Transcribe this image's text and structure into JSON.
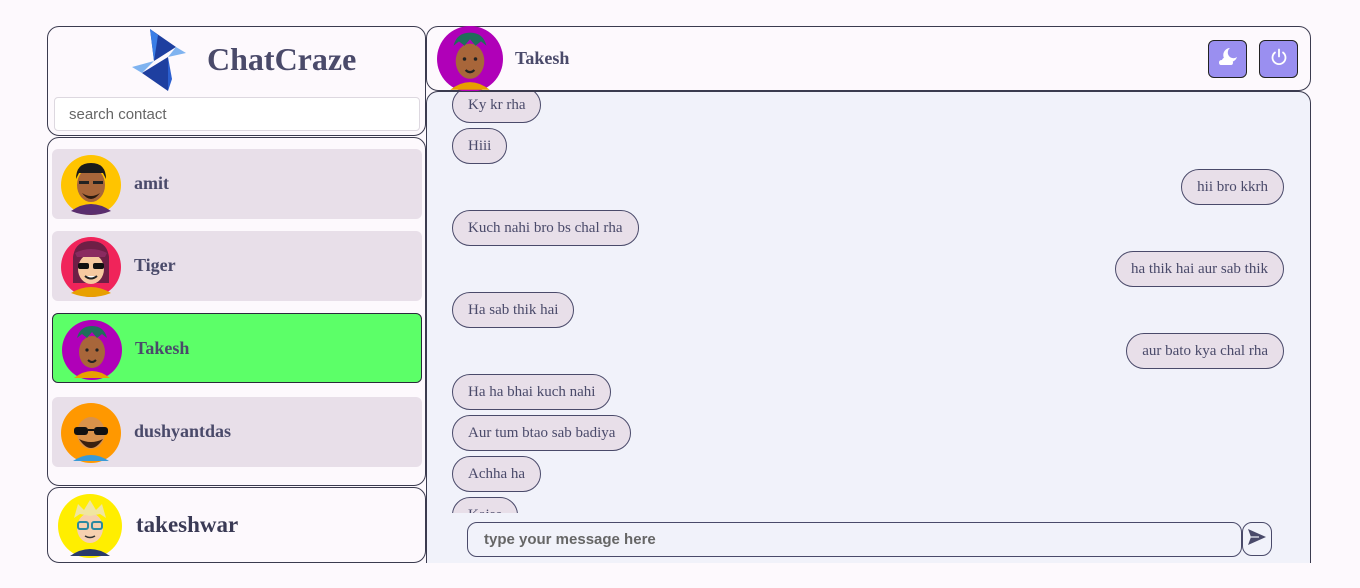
{
  "app": {
    "name": "ChatCraze",
    "logo_icon": "chatcraze-logo-icon"
  },
  "search": {
    "placeholder": "search contact"
  },
  "contacts": [
    {
      "name": "amit",
      "avatar": "avatar-bearded-man-icon",
      "active": false
    },
    {
      "name": "Tiger",
      "avatar": "avatar-sunglasses-woman-icon",
      "active": false
    },
    {
      "name": "Takesh",
      "avatar": "avatar-dreadlocks-icon",
      "active": true
    },
    {
      "name": "dushyantdas",
      "avatar": "avatar-sunglasses-beard-icon",
      "active": false
    }
  ],
  "current_user": {
    "name": "takeshwar",
    "avatar": "avatar-blond-glasses-icon"
  },
  "chat": {
    "contact_name": "Takesh",
    "contact_avatar": "avatar-dreadlocks-icon",
    "theme_button_icon": "moon-cloud-icon",
    "power_button_icon": "power-icon",
    "messages": [
      {
        "text": "Ky kr rha",
        "direction": "in"
      },
      {
        "text": "Hiii",
        "direction": "in"
      },
      {
        "text": "hii bro kkrh",
        "direction": "out"
      },
      {
        "text": "Kuch nahi bro bs chal rha",
        "direction": "in"
      },
      {
        "text": "ha thik hai aur sab thik",
        "direction": "out"
      },
      {
        "text": "Ha sab thik hai",
        "direction": "in"
      },
      {
        "text": "aur bato kya chal rha",
        "direction": "out"
      },
      {
        "text": "Ha ha bhai kuch nahi",
        "direction": "in"
      },
      {
        "text": "Aur tum btao sab badiya",
        "direction": "in"
      },
      {
        "text": "Achha ha",
        "direction": "in"
      },
      {
        "text": "Kaise",
        "direction": "in"
      }
    ],
    "composer_placeholder": "type your message here",
    "send_icon": "send-icon"
  },
  "colors": {
    "accent_button": "#9a8ff0",
    "active_contact": "#5cff68",
    "bubble": "#e8dfe9",
    "chat_background": "#f1f2fa",
    "text": "#4a4a6a"
  }
}
